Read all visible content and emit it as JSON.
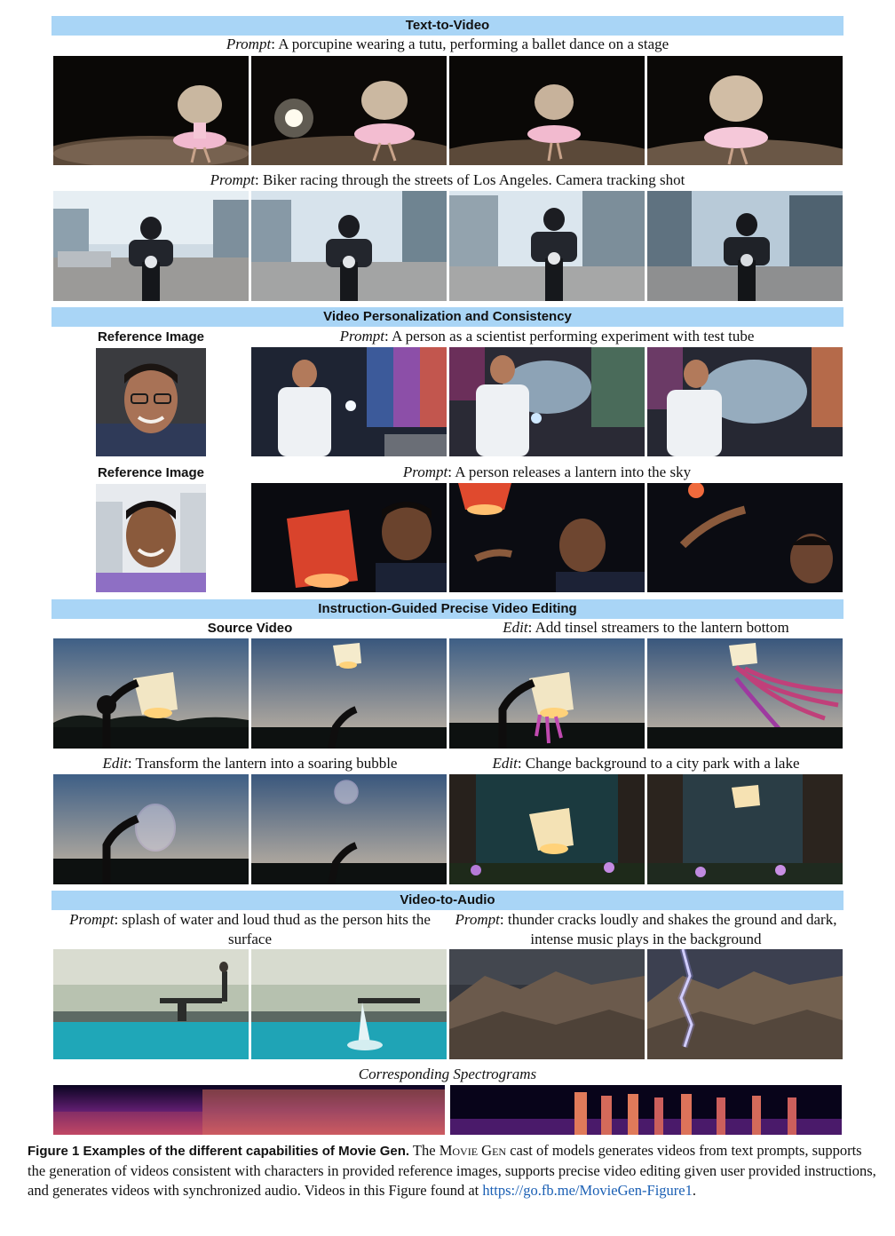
{
  "sections": {
    "t2v": "Text-to-Video",
    "personalization": "Video Personalization and Consistency",
    "editing": "Instruction-Guided Precise Video Editing",
    "v2a": "Video-to-Audio"
  },
  "labels": {
    "prompt": "Prompt",
    "edit": "Edit",
    "reference_image": "Reference Image",
    "source_video": "Source Video",
    "spectrograms": "Corresponding Spectrograms"
  },
  "captions": {
    "porcupine": ": A porcupine wearing a tutu, performing a ballet dance on a stage",
    "biker": ": Biker racing through the streets of Los Angeles. Camera tracking shot",
    "scientist": ": A person as a scientist performing experiment with test tube",
    "lantern": ": A person releases a lantern into the sky",
    "tinsel": ": Add tinsel streamers to the lantern bottom",
    "bubble": ": Transform the lantern into a soaring bubble",
    "park": ": Change background to a city park with a lake",
    "splash": ": splash of water and loud thud as the person hits the surface",
    "thunder": ": thunder cracks loudly and shakes the ground and dark, intense music plays in the background"
  },
  "figure_caption": {
    "label": "Figure 1  Examples of the different capabilities of Movie Gen.",
    "text_1": " The ",
    "smallcaps": "Movie Gen",
    "text_2": " cast of models generates videos from text prompts, supports the generation of videos consistent with characters in provided reference images, supports precise video editing given user provided instructions, and generates videos with synchronized audio. Videos in this Figure found at ",
    "link": "https://go.fb.me/MovieGen-Figure1",
    "text_3": "."
  }
}
